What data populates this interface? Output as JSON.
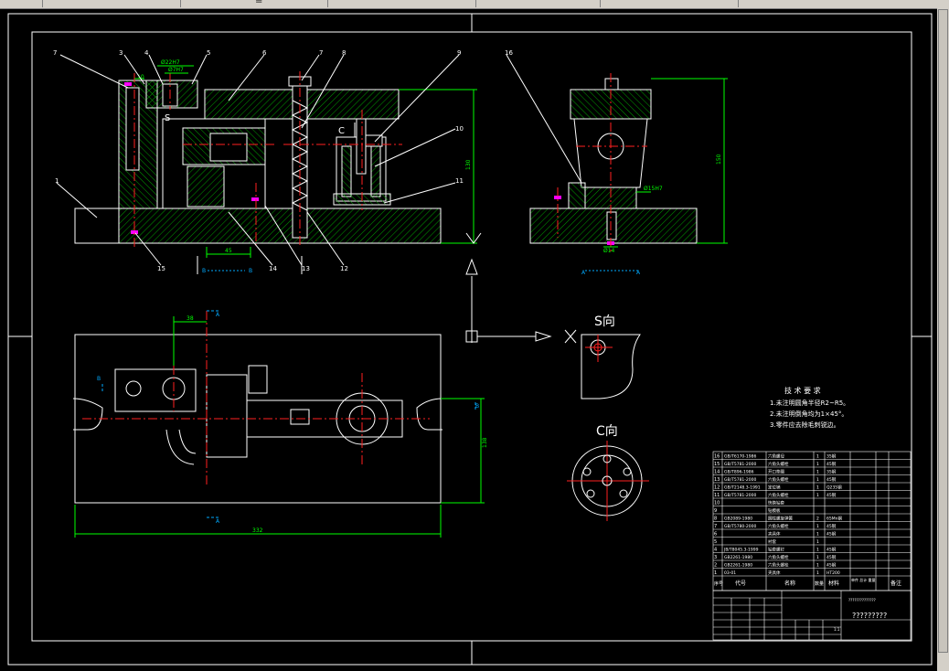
{
  "window": {
    "scroll_marker": "="
  },
  "colors": {
    "background": "#000000",
    "outline": "#ffffff",
    "hatch": "#00a000",
    "centerline": "#ff2020",
    "dimension": "#00ff00",
    "leader": "#ffffff"
  },
  "callouts": [
    "1",
    "3",
    "4",
    "5",
    "6",
    "7",
    "8",
    "9",
    "10",
    "11",
    "12",
    "13",
    "14",
    "15",
    "16"
  ],
  "callout_7a": "7",
  "dims": {
    "d1": "10",
    "d2": "Ø22H7",
    "d3": "Ø7H7",
    "d4": "130",
    "d5": "45",
    "d6": "Ø15H7",
    "d7": "150",
    "d8": "Ø14",
    "d9": "38",
    "d10": "138",
    "d11": "332"
  },
  "view_marks": {
    "s_left": "S",
    "c_left": "C",
    "b_label": "B",
    "a_label": "A",
    "section_bb_left": "B",
    "section_bb_right": "B",
    "section_aa_left": "A",
    "section_aa_right": "A"
  },
  "view_titles": {
    "s_view": "S向",
    "c_view": "C向"
  },
  "tech_req": {
    "title": "技 术 要 求",
    "items": [
      "1.未注明圆角半径R2~R5。",
      "2.未注明倒角均为1×45°。",
      "3.零件应去除毛刺锐边。"
    ]
  },
  "parts_list": {
    "rows": [
      {
        "no": "16",
        "code": "GB/T6170-1986",
        "name": "六角螺母",
        "qty": "1",
        "material": "35钢"
      },
      {
        "no": "15",
        "code": "GB/T5781-2000",
        "name": "六角头螺栓",
        "qty": "1",
        "material": "45钢"
      },
      {
        "no": "14",
        "code": "GB/T896-1986",
        "name": "开口垫圈",
        "qty": "1",
        "material": "35钢"
      },
      {
        "no": "13",
        "code": "GB/T5781-2000",
        "name": "六角头螺栓",
        "qty": "1",
        "material": "45钢"
      },
      {
        "no": "12",
        "code": "GB/T2148.3-1991",
        "name": "定位销",
        "qty": "1",
        "material": "Q235钢"
      },
      {
        "no": "11",
        "code": "GB/T5781-2000",
        "name": "六角头螺栓",
        "qty": "1",
        "material": "45钢"
      },
      {
        "no": "10",
        "code": "",
        "name": "快换钻套",
        "qty": "",
        "material": ""
      },
      {
        "no": "9",
        "code": "",
        "name": "钻模板",
        "qty": "",
        "material": ""
      },
      {
        "no": "8",
        "code": "GB2089-1980",
        "name": "圆柱螺旋弹簧",
        "qty": "2",
        "material": "65Mn钢"
      },
      {
        "no": "7",
        "code": "GB/T5780-2000",
        "name": "六角头螺栓",
        "qty": "1",
        "material": "45钢"
      },
      {
        "no": "6",
        "code": "",
        "name": "夹具体",
        "qty": "1",
        "material": "45钢"
      },
      {
        "no": "5",
        "code": "",
        "name": "衬套",
        "qty": "1",
        "material": ""
      },
      {
        "no": "4",
        "code": "JB/T8045.3-1999",
        "name": "钻套螺钉",
        "qty": "1",
        "material": "45钢"
      },
      {
        "no": "3",
        "code": "GB2261-1980",
        "name": "六角头螺栓",
        "qty": "1",
        "material": "45钢"
      },
      {
        "no": "2",
        "code": "GB2261-1980",
        "name": "六角头螺栓",
        "qty": "1",
        "material": "45钢"
      },
      {
        "no": "1",
        "code": "03-01",
        "name": "夹具体",
        "qty": "1",
        "material": "HT200"
      }
    ],
    "header": {
      "no": "序号",
      "code": "代号",
      "name": "名称",
      "qty": "数量",
      "material": "材料",
      "weight": "单件 总计 重量",
      "note": "备注"
    }
  },
  "title_block": {
    "drawing_name": "?????????",
    "sheet": "1:1",
    "school_line": "??????????????"
  }
}
